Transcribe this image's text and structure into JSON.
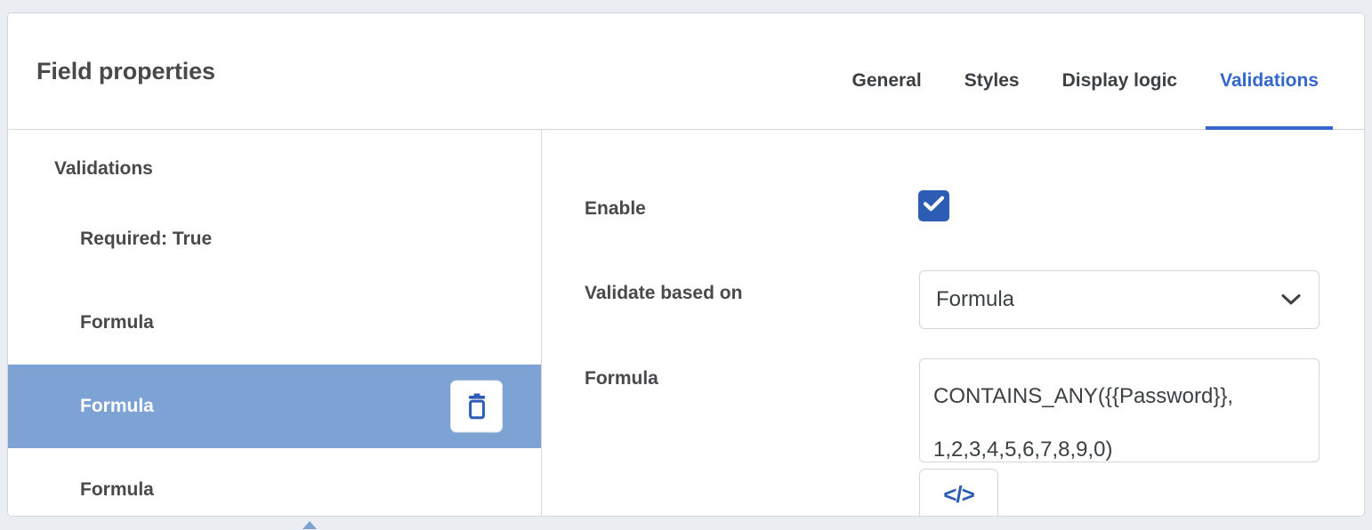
{
  "header": {
    "title": "Field properties",
    "tabs": [
      {
        "label": "General",
        "active": false
      },
      {
        "label": "Styles",
        "active": false
      },
      {
        "label": "Display logic",
        "active": false
      },
      {
        "label": "Validations",
        "active": true
      }
    ]
  },
  "sidebar": {
    "group_title": "Validations",
    "items": [
      {
        "label": "Required: True",
        "selected": false
      },
      {
        "label": "Formula",
        "selected": false
      },
      {
        "label": "Formula",
        "selected": true
      },
      {
        "label": "Formula",
        "selected": false
      }
    ],
    "delete_icon": "trash-icon"
  },
  "main": {
    "enable": {
      "label": "Enable",
      "checked": true,
      "checkbox_icon": "check-icon"
    },
    "validate_based_on": {
      "label": "Validate based on",
      "value": "Formula",
      "chevron_icon": "chevron-down-icon"
    },
    "formula": {
      "label": "Formula",
      "value": "CONTAINS_ANY({{Password}}, 1,2,3,4,5,6,7,8,9,0)",
      "code_button_label": "</>",
      "code_button_icon": "code-icon"
    }
  },
  "colors": {
    "accent_blue": "#3367cc",
    "selected_row": "#7da2d4",
    "checkbox_blue": "#2c5cb4",
    "text_dark": "#48494b",
    "border": "#d3d6dd",
    "page_bg": "#eaeef2"
  }
}
